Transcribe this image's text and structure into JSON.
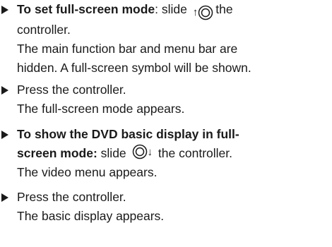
{
  "steps": [
    {
      "bold": "To set full-screen mode",
      "after_bold": ": slide",
      "icon_arrow": "up",
      "action_rest": "the",
      "line2": "controller.",
      "result_line1": "The main function bar and menu bar are",
      "result_line2": "hidden. A full-screen symbol will be shown."
    },
    {
      "action": "Press the controller.",
      "result": "The full-screen mode appears."
    },
    {
      "bold_line1": "To show the DVD basic display in full-",
      "bold_line2": "screen mode:",
      "after_bold": "slide",
      "icon_arrow": "down",
      "action_rest": "the controller.",
      "result": "The video menu appears."
    },
    {
      "action": "Press the controller.",
      "result": "The basic display appears."
    }
  ],
  "icons": {
    "bullet": "triangle-bullet-icon",
    "controller": "controller-icon",
    "slide_up": "slide-up-arrow-icon",
    "slide_down": "slide-down-arrow-icon"
  },
  "glyphs": {
    "up_arrow": "↑",
    "down_arrow": "↓"
  },
  "colors": {
    "text": "#1a1a1a",
    "background": "#ffffff"
  }
}
